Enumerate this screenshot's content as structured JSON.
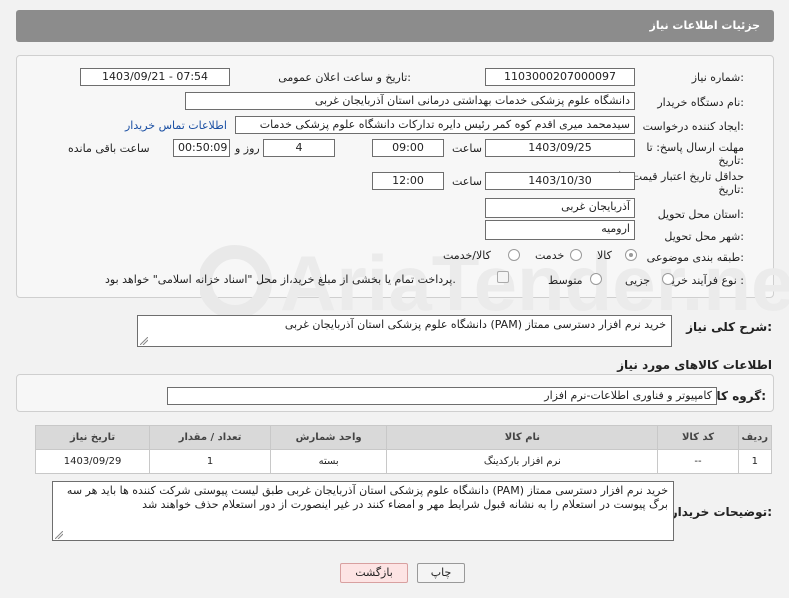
{
  "header": {
    "title": "جزئیات اطلاعات نیاز"
  },
  "form": {
    "need_number_label": "شماره نیاز:",
    "need_number": "1103000207000097",
    "announce_label": "تاریخ و ساعت اعلان عمومی:",
    "announce_value": "1403/09/21 - 07:54",
    "buyer_org_label": "نام دستگاه خریدار:",
    "buyer_org": "دانشگاه علوم پزشکی خدمات بهداشتی درمانی استان آذربایجان غربی",
    "creator_label": "ایجاد کننده درخواست:",
    "creator": "سیدمحمد میری اقدم کوه کمر رئیس دایره تدارکات دانشگاه علوم پزشکی خدمات",
    "contact_link": "اطلاعات تماس خریدار",
    "reply_deadline_label_1": "مهلت ارسال پاسخ: تا",
    "reply_deadline_label_2": "تاریخ:",
    "reply_date": "1403/09/25",
    "time_label": "ساعت",
    "reply_time": "09:00",
    "days_value": "4",
    "days_label": "روز و",
    "remaining_time": "00:50:09",
    "remaining_label": "ساعت باقی مانده",
    "price_validity_label_1": "حداقل تاریخ اعتبار قیمت: تا",
    "price_validity_label_2": "تاریخ:",
    "validity_date": "1403/10/30",
    "validity_time": "12:00",
    "province_label": "استان محل تحویل:",
    "province": "آذربایجان غربی",
    "city_label": "شهر محل تحویل:",
    "city": "ارومیه",
    "category_label": "طبقه بندی موضوعی:",
    "category_options": [
      "کالا",
      "خدمت",
      "کالا/خدمت"
    ],
    "category_selected": "کالا",
    "process_label": "نوع فرآیند خرید :",
    "process_options": [
      "جزیی",
      "متوسط"
    ],
    "payment_note": "پرداخت تمام یا بخشی از مبلغ خرید،از محل \"اسناد خزانه اسلامی\" خواهد بود."
  },
  "summary": {
    "label": "شرح کلی نیاز:",
    "text": "خرید نرم افزار دسترسی ممتاز (PAM) دانشگاه علوم پزشکی استان آذربایجان غربی"
  },
  "goods": {
    "section_title": "اطلاعات کالاهای مورد نیاز",
    "group_label": "گروه کالا:",
    "group_value": "کامپیوتر و فناوری اطلاعات-نرم افزار",
    "columns": [
      "ردیف",
      "کد کالا",
      "نام کالا",
      "واحد شمارش",
      "تعداد / مقدار",
      "تاریخ نیاز"
    ],
    "rows": [
      {
        "row": "1",
        "code": "--",
        "name": "نرم افزار بارکدینگ",
        "unit": "بسته",
        "qty": "1",
        "date": "1403/09/29"
      }
    ]
  },
  "buyer_notes": {
    "label": "توضیحات خریدار:",
    "text": "خرید نرم افزار دسترسی ممتاز (PAM) دانشگاه علوم پزشکی استان آذربایجان غربی طبق لیست پیوستی شرکت کننده ها باید هر سه برگ پیوست در استعلام را به نشانه قبول شرایط مهر و امضاء کنند در غیر اینصورت از دور استعلام حذف خواهند شد"
  },
  "buttons": {
    "print": "چاپ",
    "back": "بازگشت"
  },
  "watermark": {
    "text": "AriaTender.net",
    "color": "#e6e6e6"
  }
}
